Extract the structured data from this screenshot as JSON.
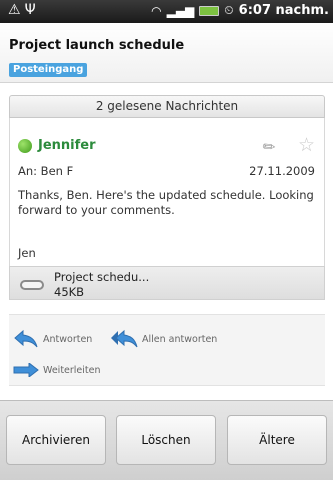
{
  "status_bar": {
    "left_icons": [
      "warning-icon",
      "usb-icon"
    ],
    "right_icons": [
      "wifi-icon",
      "signal-icon",
      "battery-icon",
      "alarm-icon"
    ],
    "time": "6:07 nachm."
  },
  "header": {
    "subject": "Project launch schedule",
    "label": "Posteingang"
  },
  "thread": {
    "read_messages_label": "2 gelesene Nachrichten"
  },
  "message": {
    "sender": "Jennifer",
    "to": "An: Ben F",
    "date": "27.11.2009",
    "body": "Thanks, Ben. Here's the updated schedule. Looking forward to your comments.",
    "signature": "Jen",
    "attachment": {
      "name": "Project schedu...",
      "size": "45KB"
    }
  },
  "actions": {
    "reply": "Antworten",
    "reply_all": "Allen antworten",
    "forward": "Weiterleiten"
  },
  "bottom_buttons": {
    "archive": "Archivieren",
    "delete": "Löschen",
    "older": "Ältere"
  },
  "colors": {
    "sender_green": "#2c8b3c",
    "label_blue": "#4aa3df",
    "action_blue": "#3f8fd8"
  }
}
